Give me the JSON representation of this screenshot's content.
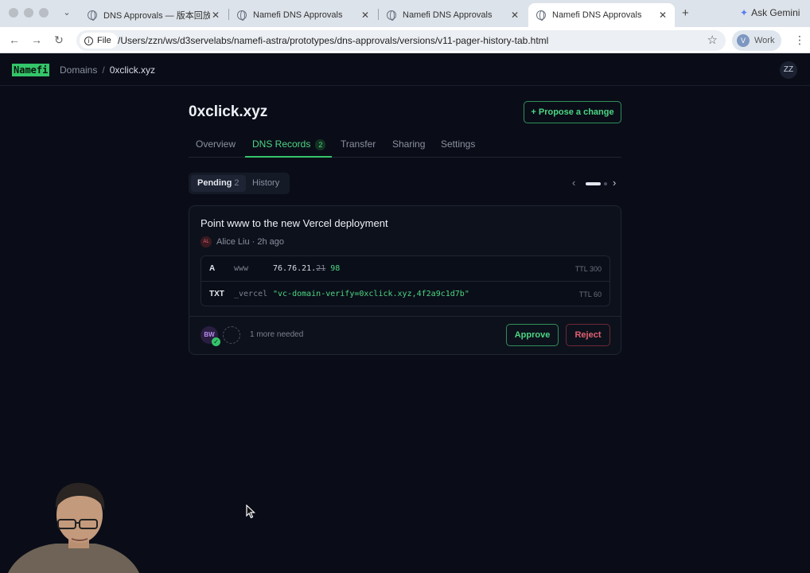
{
  "browser": {
    "tabs": [
      {
        "title": "DNS Approvals — 版本回放"
      },
      {
        "title": "Namefi DNS Approvals"
      },
      {
        "title": "Namefi DNS Approvals"
      },
      {
        "title": "Namefi DNS Approvals"
      }
    ],
    "ask_gemini": "Ask Gemini",
    "file_chip": "File",
    "url": "/Users/zzn/ws/d3servelabs/namefi-astra/prototypes/dns-approvals/versions/v11-pager-history-tab.html",
    "profile_initial": "V",
    "profile_label": "Work"
  },
  "app": {
    "logo": "Namefi",
    "breadcrumb": {
      "root": "Domains",
      "separator": "/",
      "current": "0xclick.xyz"
    },
    "user_initials": "ZZ",
    "domain": "0xclick.xyz",
    "propose_label": "+ Propose a change",
    "tabs": [
      {
        "label": "Overview"
      },
      {
        "label": "DNS Records",
        "count": "2"
      },
      {
        "label": "Transfer"
      },
      {
        "label": "Sharing"
      },
      {
        "label": "Settings"
      }
    ],
    "segment": {
      "pending_label": "Pending",
      "pending_count": "2",
      "history_label": "History"
    },
    "pager": {
      "prev": "‹",
      "next": "›",
      "current_page": 1,
      "total_pages": 2
    },
    "proposal": {
      "title": "Point www to the new Vercel deployment",
      "author_initials": "AL",
      "author": "Alice Liu",
      "time": "· 2h ago",
      "records": [
        {
          "type": "A",
          "name": "www",
          "value_prefix": "76.76.21.",
          "value_old": "21",
          "value_new": "98",
          "ttl": "TTL 300"
        },
        {
          "type": "TXT",
          "name": "_vercel",
          "value": "\"vc-domain-verify=0xclick.xyz,4f2a9c1d7b\"",
          "ttl": "TTL 60"
        }
      ],
      "approver_initials": "BW",
      "approvals_status": "1 more needed",
      "approve_label": "Approve",
      "reject_label": "Reject"
    }
  },
  "colors": {
    "background": "#0a0d18",
    "accent": "#34c56a",
    "danger": "#e06070"
  }
}
